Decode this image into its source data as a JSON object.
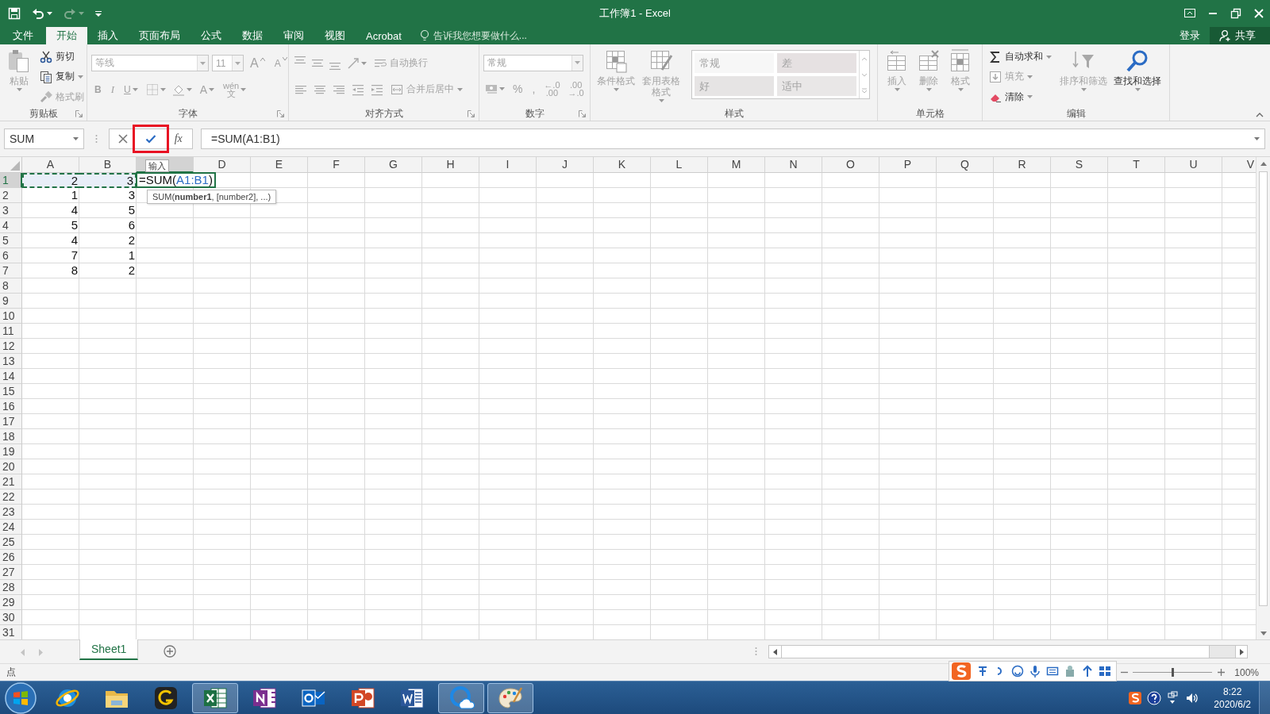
{
  "quick_access": {
    "redo": {
      "disabled": true
    }
  },
  "window": {
    "title": "工作簿1 - Excel"
  },
  "menu_tabs": [
    {
      "label": "文件",
      "selected": false
    },
    {
      "label": "开始",
      "selected": true
    },
    {
      "label": "插入",
      "selected": false
    },
    {
      "label": "页面布局",
      "selected": false
    },
    {
      "label": "公式",
      "selected": false
    },
    {
      "label": "数据",
      "selected": false
    },
    {
      "label": "审阅",
      "selected": false
    },
    {
      "label": "视图",
      "selected": false
    },
    {
      "label": "Acrobat",
      "selected": false
    }
  ],
  "tell_me": "告诉我您想要做什么...",
  "account": {
    "sign_in": "登录",
    "share": "共享"
  },
  "ribbon": {
    "groups": [
      {
        "label": "剪贴板",
        "launcher": true,
        "sections": [
          {
            "kind": "buttons",
            "items": [
              {
                "kind": "large",
                "label": "粘贴",
                "dropdown": true,
                "disabled": true
              }
            ]
          },
          {
            "kind": "lines",
            "lines": [
              [
                {
                  "kind": "small",
                  "label": "剪切",
                  "dropdown": false,
                  "disabled": false
                }
              ],
              [
                {
                  "kind": "small",
                  "label": "复制",
                  "dropdown": true,
                  "disabled": false
                }
              ],
              [
                {
                  "kind": "small",
                  "label": "格式刷",
                  "dropdown": false,
                  "disabled": true
                }
              ]
            ]
          }
        ]
      },
      {
        "label": "字体",
        "launcher": true,
        "sections": [
          {
            "kind": "lines",
            "lines": [
              [
                {
                  "kind": "combo",
                  "value": "等线",
                  "disabled": true
                },
                {
                  "kind": "combo",
                  "value": "11",
                  "disabled": true
                },
                {
                  "kind": "grow",
                  "label": "A",
                  "disabled": true
                },
                {
                  "kind": "shrink",
                  "label": "A",
                  "disabled": true
                }
              ],
              [
                {
                  "kind": "glyph",
                  "label": "B",
                  "dropdown": false,
                  "disabled": true
                },
                {
                  "kind": "glyph",
                  "label": "I",
                  "dropdown": false,
                  "disabled": true
                },
                {
                  "kind": "glyph",
                  "label": "U",
                  "dropdown": true,
                  "disabled": true
                },
                {
                  "kind": "icon",
                  "dropdown": true,
                  "disabled": true
                },
                {
                  "kind": "icon",
                  "dropdown": true,
                  "disabled": true
                },
                {
                  "kind": "glyph",
                  "label": "A",
                  "dropdown": true,
                  "disabled": true
                },
                {
                  "kind": "stack",
                  "label": "wén\n文",
                  "dropdown": true,
                  "disabled": true
                }
              ]
            ]
          }
        ]
      },
      {
        "label": "对齐方式",
        "launcher": true,
        "sections": [
          {
            "kind": "lines",
            "lines": [
              [
                {
                  "kind": "icon",
                  "dropdown": false,
                  "disabled": true
                },
                {
                  "kind": "icon",
                  "dropdown": false,
                  "disabled": true
                },
                {
                  "kind": "icon",
                  "dropdown": false,
                  "disabled": true
                },
                {
                  "kind": "icon",
                  "dropdown": true,
                  "disabled": true
                },
                {
                  "kind": "small",
                  "label": "自动换行",
                  "dropdown": false,
                  "disabled": true
                }
              ],
              [
                {
                  "kind": "icon",
                  "dropdown": false,
                  "disabled": true
                },
                {
                  "kind": "icon",
                  "dropdown": false,
                  "disabled": true
                },
                {
                  "kind": "icon",
                  "dropdown": false,
                  "disabled": true
                },
                {
                  "kind": "icon",
                  "dropdown": false,
                  "disabled": true
                },
                {
                  "kind": "icon",
                  "dropdown": false,
                  "disabled": true
                },
                {
                  "kind": "small",
                  "label": "合并后居中",
                  "dropdown": true,
                  "disabled": true
                }
              ]
            ]
          }
        ]
      },
      {
        "label": "数字",
        "launcher": true,
        "sections": [
          {
            "kind": "lines",
            "lines": [
              [
                {
                  "kind": "combo",
                  "value": "常规",
                  "disabled": true
                }
              ],
              [
                {
                  "kind": "icon",
                  "dropdown": true,
                  "disabled": true
                },
                {
                  "kind": "glyph",
                  "label": "%",
                  "dropdown": false,
                  "disabled": true
                },
                {
                  "kind": "glyph",
                  "label": ",",
                  "dropdown": false,
                  "disabled": true
                },
                {
                  "kind": "stack",
                  "label": "←.0\n.00",
                  "dropdown": false,
                  "disabled": true
                },
                {
                  "kind": "stack",
                  "label": ".00\n→.0",
                  "dropdown": false,
                  "disabled": true
                }
              ]
            ]
          }
        ]
      },
      {
        "label": "样式",
        "launcher": false,
        "sections": [
          {
            "kind": "buttons",
            "items": [
              {
                "kind": "large",
                "label": "条件格式",
                "dropdown": true,
                "disabled": true
              },
              {
                "kind": "large",
                "label": "套用表格格式",
                "dropdown": true,
                "disabled": true
              }
            ]
          },
          {
            "kind": "gallery",
            "items": [
              {
                "kind": "style",
                "label": "常规",
                "disabled": true
              },
              {
                "kind": "style",
                "label": "差",
                "disabled": true
              },
              {
                "kind": "style",
                "label": "好",
                "disabled": true
              },
              {
                "kind": "style",
                "label": "适中",
                "disabled": true
              }
            ]
          }
        ]
      },
      {
        "label": "单元格",
        "launcher": false,
        "sections": [
          {
            "kind": "buttons",
            "items": [
              {
                "kind": "large",
                "label": "插入",
                "dropdown": true,
                "disabled": true
              },
              {
                "kind": "large",
                "label": "删除",
                "dropdown": true,
                "disabled": true
              },
              {
                "kind": "large",
                "label": "格式",
                "dropdown": true,
                "disabled": true
              }
            ]
          }
        ]
      },
      {
        "label": "编辑",
        "launcher": false,
        "sections": [
          {
            "kind": "lines",
            "lines": [
              [
                {
                  "kind": "small",
                  "label": "自动求和",
                  "dropdown": true,
                  "disabled": false
                }
              ],
              [
                {
                  "kind": "small",
                  "label": "填充",
                  "dropdown": true,
                  "disabled": true
                }
              ],
              [
                {
                  "kind": "small",
                  "label": "清除",
                  "dropdown": true,
                  "disabled": false
                }
              ]
            ]
          },
          {
            "kind": "buttons",
            "items": [
              {
                "kind": "large",
                "label": "排序和筛选",
                "dropdown": true,
                "disabled": true
              },
              {
                "kind": "large",
                "label": "查找和选择",
                "dropdown": true,
                "disabled": false
              }
            ]
          }
        ]
      }
    ]
  },
  "formula_bar": {
    "name_box": "SUM",
    "enter": {
      "highlighted": true
    },
    "insert_function": "fx",
    "formula": "=SUM(A1:B1)",
    "tooltip": "输入"
  },
  "sheet": {
    "columns": [
      {
        "label": "A",
        "selected": false
      },
      {
        "label": "B",
        "selected": false
      },
      {
        "selected": true
      },
      {
        "label": "D",
        "selected": false
      },
      {
        "label": "E",
        "selected": false
      },
      {
        "label": "F",
        "selected": false
      },
      {
        "label": "G",
        "selected": false
      },
      {
        "label": "H",
        "selected": false
      },
      {
        "label": "I",
        "selected": false
      },
      {
        "label": "J",
        "selected": false
      },
      {
        "label": "K",
        "selected": false
      },
      {
        "label": "L",
        "selected": false
      },
      {
        "label": "M",
        "selected": false
      },
      {
        "label": "N",
        "selected": false
      },
      {
        "label": "O",
        "selected": false
      },
      {
        "label": "P",
        "selected": false
      },
      {
        "label": "Q",
        "selected": false
      },
      {
        "label": "R",
        "selected": false
      },
      {
        "label": "S",
        "selected": false
      },
      {
        "label": "T",
        "selected": false
      },
      {
        "label": "U",
        "selected": false
      },
      {
        "label": "V",
        "selected": false
      }
    ],
    "rows": [
      {
        "header": "1",
        "selected": true,
        "cells": [
          {
            "kind": "value",
            "value": "2",
            "marquee": true
          },
          {
            "kind": "value",
            "value": "3",
            "marquee": true
          },
          {
            "kind": "editing",
            "parts": [
              {
                "text": "=SUM(",
                "reference": false
              },
              {
                "text": "A1:B1",
                "reference": true
              },
              {
                "text": ")",
                "reference": false
              }
            ]
          }
        ]
      },
      {
        "header": "2",
        "selected": false,
        "cells": [
          {
            "kind": "value",
            "value": "1",
            "marquee": false
          },
          {
            "kind": "value",
            "value": "3",
            "marquee": false
          }
        ]
      },
      {
        "header": "3",
        "selected": false,
        "cells": [
          {
            "kind": "value",
            "value": "4",
            "marquee": false
          },
          {
            "kind": "value",
            "value": "5",
            "marquee": false
          }
        ]
      },
      {
        "header": "4",
        "selected": false,
        "cells": [
          {
            "kind": "value",
            "value": "5",
            "marquee": false
          },
          {
            "kind": "value",
            "value": "6",
            "marquee": false
          }
        ]
      },
      {
        "header": "5",
        "selected": false,
        "cells": [
          {
            "kind": "value",
            "value": "4",
            "marquee": false
          },
          {
            "kind": "value",
            "value": "2",
            "marquee": false
          }
        ]
      },
      {
        "header": "6",
        "selected": false,
        "cells": [
          {
            "kind": "value",
            "value": "7",
            "marquee": false
          },
          {
            "kind": "value",
            "value": "1",
            "marquee": false
          }
        ]
      },
      {
        "header": "7",
        "selected": false,
        "cells": [
          {
            "kind": "value",
            "value": "8",
            "marquee": false
          },
          {
            "kind": "value",
            "value": "2",
            "marquee": false
          }
        ]
      },
      {
        "header": "8",
        "selected": false
      },
      {
        "header": "9",
        "selected": false
      },
      {
        "header": "10",
        "selected": false
      },
      {
        "header": "11",
        "selected": false
      },
      {
        "header": "12",
        "selected": false
      },
      {
        "header": "13",
        "selected": false
      },
      {
        "header": "14",
        "selected": false
      },
      {
        "header": "15",
        "selected": false
      },
      {
        "header": "16",
        "selected": false
      },
      {
        "header": "17",
        "selected": false
      },
      {
        "header": "18",
        "selected": false
      },
      {
        "header": "19",
        "selected": false
      },
      {
        "header": "20",
        "selected": false
      },
      {
        "header": "21",
        "selected": false
      },
      {
        "header": "22",
        "selected": false
      },
      {
        "header": "23",
        "selected": false
      },
      {
        "header": "24",
        "selected": false
      },
      {
        "header": "25",
        "selected": false
      },
      {
        "header": "26",
        "selected": false
      },
      {
        "header": "27",
        "selected": false
      },
      {
        "header": "28",
        "selected": false
      },
      {
        "header": "29",
        "selected": false
      },
      {
        "header": "30",
        "selected": false
      },
      {
        "header": "31",
        "selected": false
      }
    ],
    "function_tip": "SUM(**number1**, [number2], ...)"
  },
  "sheet_tabs": [
    {
      "label": "Sheet1",
      "selected": true
    }
  ],
  "status_bar": {
    "mode": "点",
    "zoom": {
      "level": 0.5,
      "reading": "100%"
    }
  },
  "taskbar": {
    "apps": [
      {
        "kind": "browser",
        "running": false
      },
      {
        "kind": "folder",
        "running": false
      },
      {
        "kind": "app",
        "running": false
      },
      {
        "kind": "spreadsheet",
        "running": true
      },
      {
        "kind": "notebook",
        "running": false
      },
      {
        "kind": "mail",
        "running": false
      },
      {
        "kind": "slides",
        "running": false
      },
      {
        "kind": "document",
        "running": false
      },
      {
        "kind": "cloud",
        "running": true
      },
      {
        "kind": "palette",
        "running": true
      }
    ],
    "clock": {
      "time": "8:22",
      "date": "2020/6/2"
    }
  }
}
